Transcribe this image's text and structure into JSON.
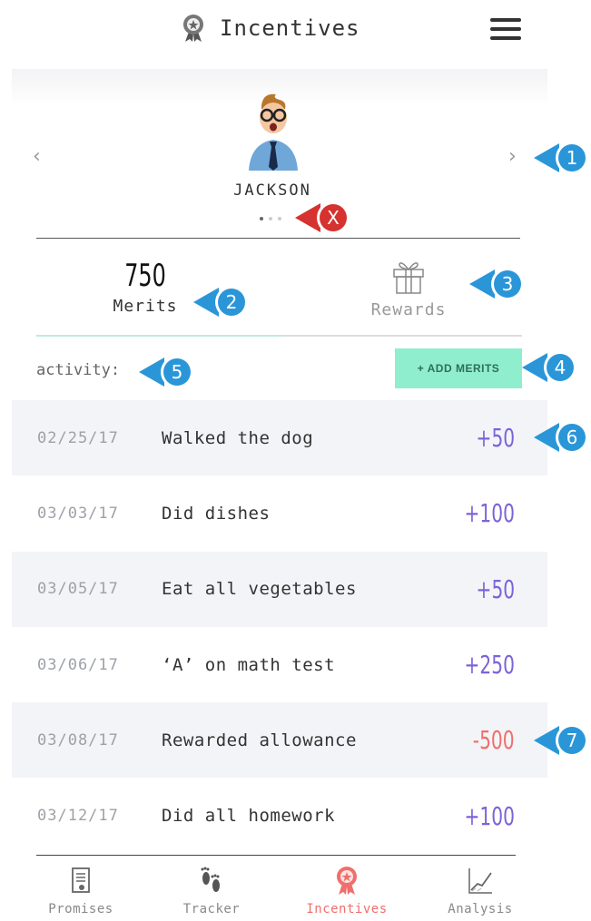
{
  "header": {
    "title": "Incentives",
    "title_icon": "award-ribbon-icon",
    "menu_icon": "hamburger-menu-icon"
  },
  "profile": {
    "name": "JACKSON",
    "avatar": "child-avatar",
    "prev_icon": "chevron-left-icon",
    "next_icon": "chevron-right-icon",
    "page_count": 3,
    "active_page": 1
  },
  "tabs": {
    "merits_count": "750",
    "merits_label": "Merits",
    "rewards_label": "Rewards",
    "rewards_icon": "gift-icon",
    "active": "merits"
  },
  "activity": {
    "label": "activity:",
    "add_button": "+ ADD MERITS",
    "rows": [
      {
        "date": "02/25/17",
        "description": "Walked the dog",
        "amount": "+50",
        "type": "positive"
      },
      {
        "date": "03/03/17",
        "description": "Did dishes",
        "amount": "+100",
        "type": "positive"
      },
      {
        "date": "03/05/17",
        "description": "Eat all vegetables",
        "amount": "+50",
        "type": "positive"
      },
      {
        "date": "03/06/17",
        "description": "‘A’ on math test",
        "amount": "+250",
        "type": "positive"
      },
      {
        "date": "03/08/17",
        "description": "Rewarded allowance",
        "amount": "-500",
        "type": "negative"
      },
      {
        "date": "03/12/17",
        "description": "Did all homework",
        "amount": "+100",
        "type": "positive"
      }
    ]
  },
  "nav": {
    "items": [
      {
        "label": "Promises",
        "icon": "document-icon"
      },
      {
        "label": "Tracker",
        "icon": "footprints-icon"
      },
      {
        "label": "Incentives",
        "icon": "award-ribbon-icon"
      },
      {
        "label": "Analysis",
        "icon": "line-chart-icon"
      }
    ],
    "active": "Incentives"
  },
  "callouts": [
    {
      "label": "1",
      "color": "#2a96d8"
    },
    {
      "label": "X",
      "color": "#d6322f"
    },
    {
      "label": "2",
      "color": "#2a96d8"
    },
    {
      "label": "3",
      "color": "#2a96d8"
    },
    {
      "label": "4",
      "color": "#2a96d8"
    },
    {
      "label": "5",
      "color": "#2a96d8"
    },
    {
      "label": "6",
      "color": "#2a96d8"
    },
    {
      "label": "7",
      "color": "#2a96d8"
    }
  ],
  "colors": {
    "accent_positive": "#7d63d9",
    "accent_negative": "#ef6f6c",
    "add_button_bg": "#8feecd",
    "active_tab_underline": "#b9ede1",
    "callout_blue": "#2a96d8",
    "callout_red": "#d6322f"
  }
}
